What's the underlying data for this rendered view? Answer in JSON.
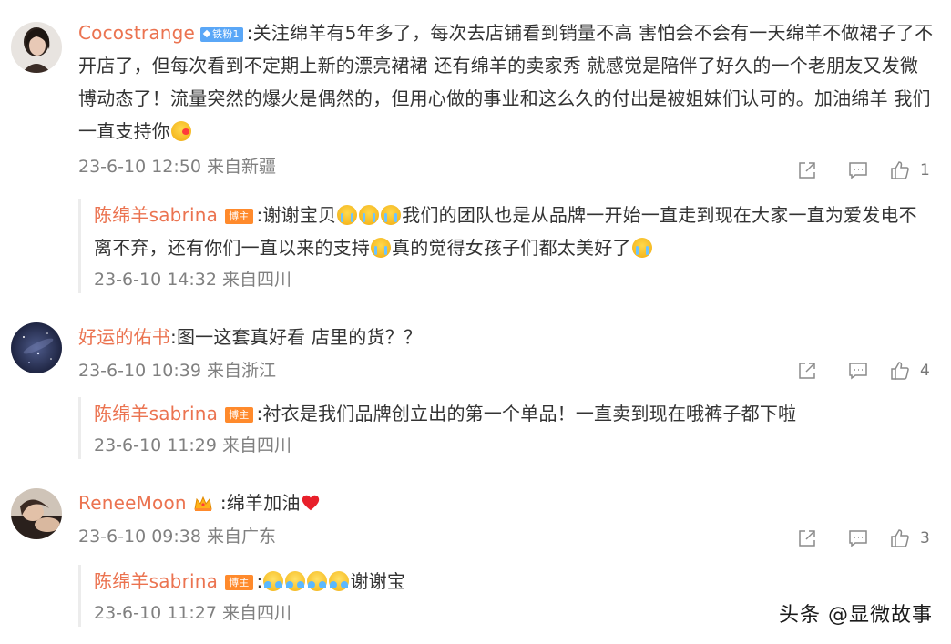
{
  "comments": [
    {
      "username": "Cocostrange",
      "badge": "铁粉1",
      "text": ":关注绵羊有5年多了，每次去店铺看到销量不高 害怕会不会有一天绵羊不做裙子了不开店了，但每次看到不定期上新的漂亮裙裙 还有绵羊的卖家秀 就感觉是陪伴了好久的一个老朋友又发微博动态了！流量突然的爆火是偶然的，但用心做的事业和这么久的付出是被姐妹们认可的。加油绵羊 我们一直支持你",
      "emoji_end": "kiss-emoji",
      "time": "23-6-10 12:50 来自新疆",
      "likes": "1",
      "reply": {
        "username": "陈绵羊sabrina",
        "badge": "博主",
        "text_a": ":谢谢宝贝",
        "text_b": "我们的团队也是从品牌一开始一直走到现在大家一直为爱发电不离不弃，还有你们一直以来的支持",
        "text_c": "真的觉得女孩子们都太美好了",
        "time": "23-6-10 14:32 来自四川"
      }
    },
    {
      "username": "好运的佑书",
      "text": ":图一这套真好看  店里的货？？",
      "time": "23-6-10 10:39 来自浙江",
      "likes": "4",
      "reply": {
        "username": "陈绵羊sabrina",
        "badge": "博主",
        "text": ":衬衣是我们品牌创立出的第一个单品！一直卖到现在哦裤子都下啦",
        "time": "23-6-10 11:29 来自四川"
      }
    },
    {
      "username": "ReneeMoon",
      "text": ":绵羊加油",
      "time": "23-6-10 09:38 来自广东",
      "likes": "3",
      "reply": {
        "username": "陈绵羊sabrina",
        "badge": "博主",
        "text_a": ":",
        "text_b": "谢谢宝",
        "time": "23-6-10 11:27 来自四川"
      }
    }
  ],
  "watermark": "头条 @显微故事",
  "colors": {
    "username": "#eb7350",
    "fan_badge": "#5aa7f7",
    "host_badge": "#ff8a2c",
    "meta": "#808080"
  },
  "icons": {
    "share": "share-icon",
    "comment": "comment-icon",
    "like": "like-icon"
  }
}
